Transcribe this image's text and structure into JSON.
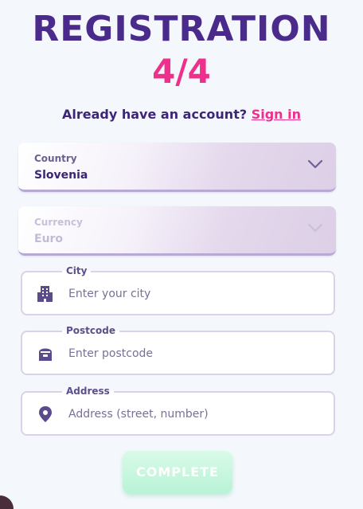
{
  "header": {
    "title": "REGISTRATION",
    "step": "4/4"
  },
  "signin": {
    "prompt": "Already have an account?",
    "link": "Sign in"
  },
  "form": {
    "country": {
      "label": "Country",
      "value": "Slovenia",
      "icon": "chevron-down-icon"
    },
    "currency": {
      "label": "Currency",
      "value": "Euro",
      "icon": "chevron-down-icon",
      "disabled": true
    },
    "city": {
      "label": "City",
      "placeholder": "Enter your city",
      "icon": "building-icon"
    },
    "postcode": {
      "label": "Postcode",
      "placeholder": "Enter postcode",
      "icon": "mailbox-icon"
    },
    "address": {
      "label": "Address",
      "placeholder": "Address (street, number)",
      "icon": "location-pin-icon"
    },
    "submit_label": "COMPLETE"
  },
  "colors": {
    "title": "#4a2a8a",
    "accent": "#ee2f8b",
    "button": "#b8f3d6"
  }
}
